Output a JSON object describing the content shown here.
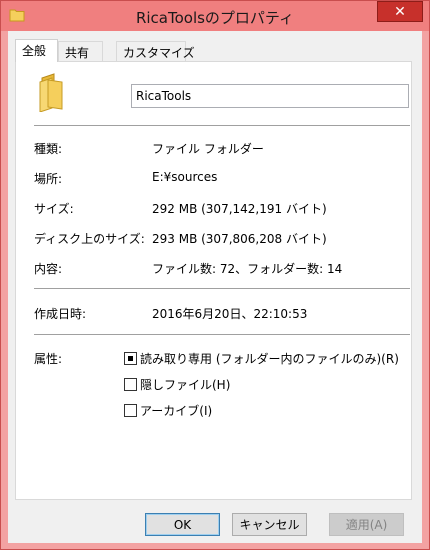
{
  "window": {
    "title": "RicaToolsのプロパティ",
    "close_label": "✕"
  },
  "tabs": [
    {
      "label": "全般",
      "active": true
    },
    {
      "label": "共有",
      "active": false
    },
    {
      "label": "カスタマイズ",
      "active": false
    }
  ],
  "general": {
    "name": "RicaTools",
    "type_label": "種類:",
    "type_value": "ファイル フォルダー",
    "location_label": "場所:",
    "location_value": "E:¥sources",
    "size_label": "サイズ:",
    "size_value": "292 MB (307,142,191 バイト)",
    "disk_size_label": "ディスク上のサイズ:",
    "disk_size_value": "293 MB (307,806,208 バイト)",
    "contents_label": "内容:",
    "contents_value": "ファイル数: 72、フォルダー数: 14",
    "created_label": "作成日時:",
    "created_value": "2016年6月20日、22:10:53",
    "attributes_label": "属性:",
    "attributes": [
      {
        "label": "読み取り専用 (フォルダー内のファイルのみ)(R)",
        "checked": true
      },
      {
        "label": "隠しファイル(H)",
        "checked": false
      },
      {
        "label": "アーカイブ(I)",
        "checked": false
      }
    ]
  },
  "buttons": {
    "ok": "OK",
    "cancel": "キャンセル",
    "apply": "適用(A)"
  },
  "colors": {
    "titlebar": "#f07f7f",
    "close_button": "#c7302b",
    "folder": "#f5cf5c"
  }
}
